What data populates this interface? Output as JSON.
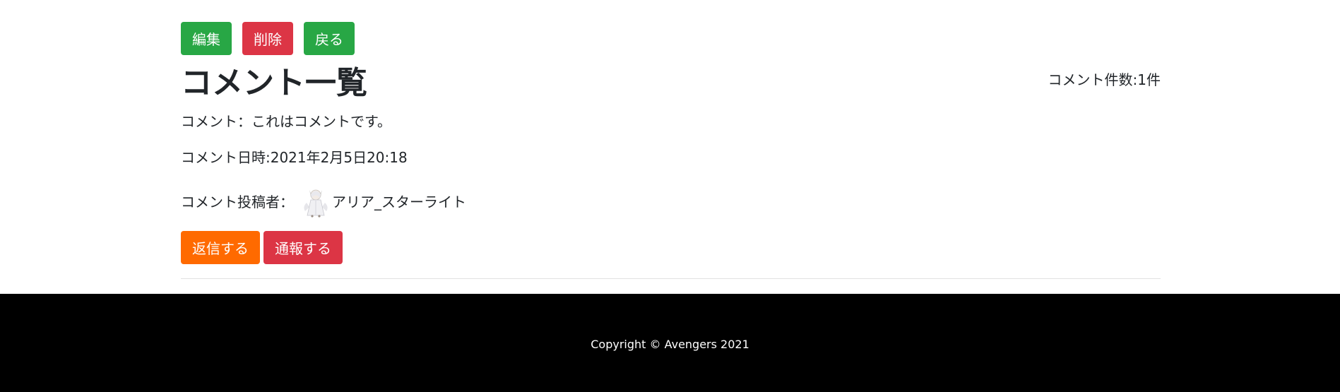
{
  "actions": {
    "edit_label": "編集",
    "delete_label": "削除",
    "back_label": "戻る"
  },
  "header": {
    "title": "コメント一覧",
    "count": "コメント件数:1件"
  },
  "comment": {
    "body": "コメント：これはコメントです。",
    "datetime": "コメント日時:2021年2月5日20:18",
    "author_label": "コメント投稿者：",
    "author_name": "アリア_スターライト",
    "reply_label": "返信する",
    "report_label": "通報する"
  },
  "footer": {
    "copyright": "Copyright © Avengers 2021"
  },
  "colors": {
    "green": "#28a745",
    "red": "#dc3545",
    "orange": "#ff6a00",
    "footer_bg": "#000000"
  }
}
